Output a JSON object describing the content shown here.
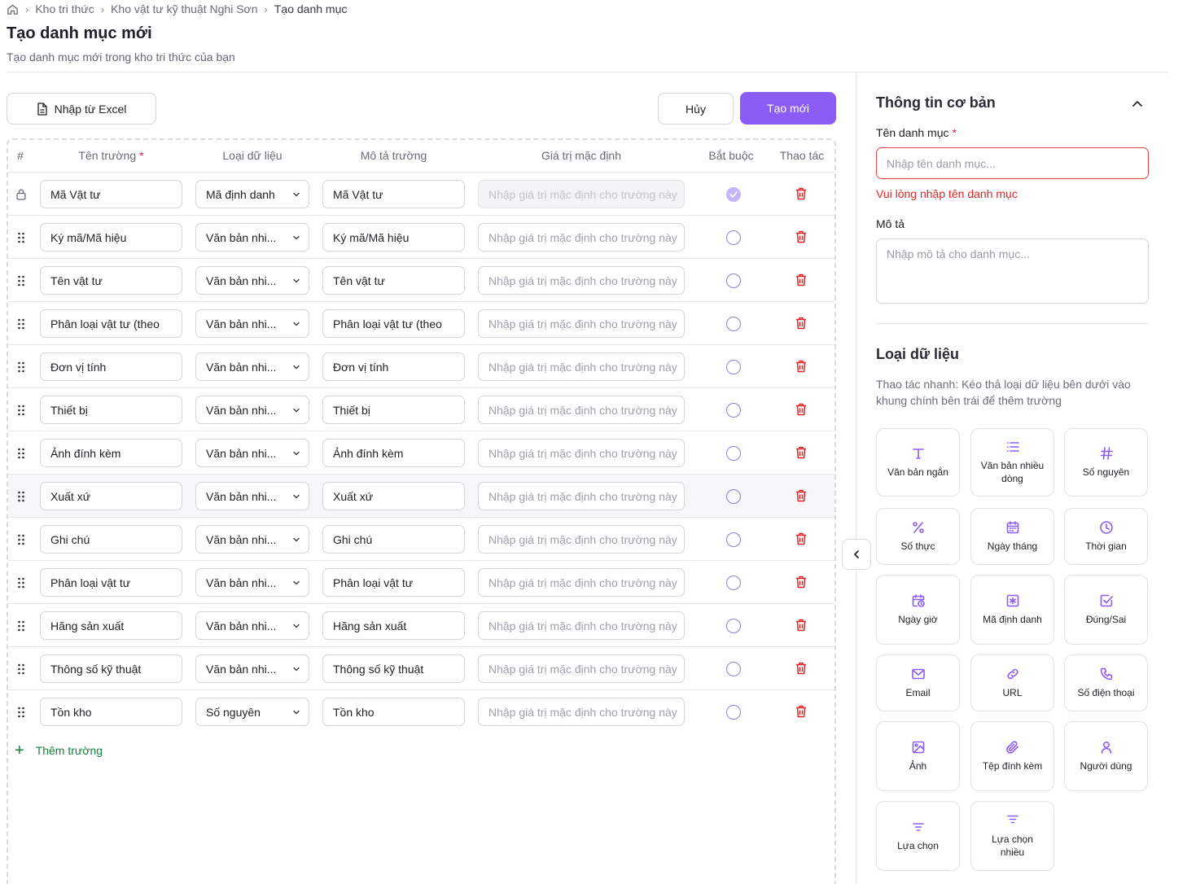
{
  "breadcrumb": {
    "items": [
      "Kho tri thức",
      "Kho vật tư kỹ thuật Nghi Sơn",
      "Tạo danh mục"
    ]
  },
  "page": {
    "title": "Tạo danh mục mới",
    "subtitle": "Tạo danh mục mới trong kho tri thức của bạn"
  },
  "toolbar": {
    "import_label": "Nhập từ Excel",
    "cancel_label": "Hủy",
    "create_label": "Tạo mới"
  },
  "table": {
    "headers": {
      "index": "#",
      "name": "Tên trường",
      "type": "Loại dữ liệu",
      "desc": "Mô tả trường",
      "default": "Giá trị mặc định",
      "required": "Bắt buộc",
      "actions": "Thao tác"
    },
    "default_placeholder": "Nhập giá trị mặc định cho trường này",
    "rows": [
      {
        "name": "Mã Vật tư",
        "type": "Mã định danh",
        "desc": "Mã Vật tư",
        "required": true,
        "locked": true
      },
      {
        "name": "Ký mã/Mã hiệu",
        "type": "Văn bản nhi...",
        "desc": "Ký mã/Mã hiệu",
        "required": false
      },
      {
        "name": "Tên vật tư",
        "type": "Văn bản nhi...",
        "desc": "Tên vật tư",
        "required": false
      },
      {
        "name": "Phân loại vật tư (theo",
        "type": "Văn bản nhi...",
        "desc": "Phân loại vật tư (theo",
        "required": false
      },
      {
        "name": "Đơn vị tính",
        "type": "Văn bản nhi...",
        "desc": "Đơn vị tính",
        "required": false
      },
      {
        "name": "Thiết bị",
        "type": "Văn bản nhi...",
        "desc": "Thiết bị",
        "required": false
      },
      {
        "name": "Ảnh đính kèm",
        "type": "Văn bản nhi...",
        "desc": "Ảnh đính kèm",
        "required": false
      },
      {
        "name": "Xuất xứ",
        "type": "Văn bản nhi...",
        "desc": "Xuất xứ",
        "required": false,
        "highlight": true
      },
      {
        "name": "Ghi chú",
        "type": "Văn bản nhi...",
        "desc": "Ghi chú",
        "required": false
      },
      {
        "name": "Phân loại vật tư",
        "type": "Văn bản nhi...",
        "desc": "Phân loại vật tư",
        "required": false
      },
      {
        "name": "Hãng sản xuất",
        "type": "Văn bản nhi...",
        "desc": "Hãng sản xuất",
        "required": false
      },
      {
        "name": "Thông số kỹ thuật",
        "type": "Văn bản nhi...",
        "desc": "Thông số kỹ thuật",
        "required": false
      },
      {
        "name": "Tồn kho",
        "type": "Số nguyên",
        "desc": "Tồn kho",
        "required": false
      }
    ],
    "add_label": "Thêm trường"
  },
  "basic_info": {
    "title": "Thông tin cơ bản",
    "name_label": "Tên danh mục",
    "name_placeholder": "Nhập tên danh mục...",
    "name_error": "Vui lòng nhập tên danh mục",
    "desc_label": "Mô tả",
    "desc_placeholder": "Nhập mô tả cho danh mục..."
  },
  "data_types": {
    "title": "Loại dữ liệu",
    "hint": "Thao tác nhanh: Kéo thả loại dữ liệu bên dưới vào khung chính bên trái để thêm trường",
    "accent": "#8b5cf6",
    "items": [
      {
        "label": "Văn bản ngắn",
        "icon": "text-icon"
      },
      {
        "label": "Văn bản nhiều dòng",
        "icon": "multiline-icon"
      },
      {
        "label": "Số nguyên",
        "icon": "hash-icon"
      },
      {
        "label": "Số thực",
        "icon": "percent-icon"
      },
      {
        "label": "Ngày tháng",
        "icon": "calendar-icon"
      },
      {
        "label": "Thời gian",
        "icon": "clock-icon"
      },
      {
        "label": "Ngày giờ",
        "icon": "calendar-clock-icon"
      },
      {
        "label": "Mã định danh",
        "icon": "id-icon"
      },
      {
        "label": "Đúng/Sai",
        "icon": "checkbox-icon"
      },
      {
        "label": "Email",
        "icon": "mail-icon"
      },
      {
        "label": "URL",
        "icon": "link-icon"
      },
      {
        "label": "Số điện thoại",
        "icon": "phone-icon"
      },
      {
        "label": "Ảnh",
        "icon": "image-icon"
      },
      {
        "label": "Tệp đính kèm",
        "icon": "paperclip-icon"
      },
      {
        "label": "Người dùng",
        "icon": "user-icon"
      },
      {
        "label": "Lựa chọn",
        "icon": "filter-icon"
      },
      {
        "label": "Lựa chọn nhiều",
        "icon": "filter-multi-icon"
      }
    ]
  }
}
